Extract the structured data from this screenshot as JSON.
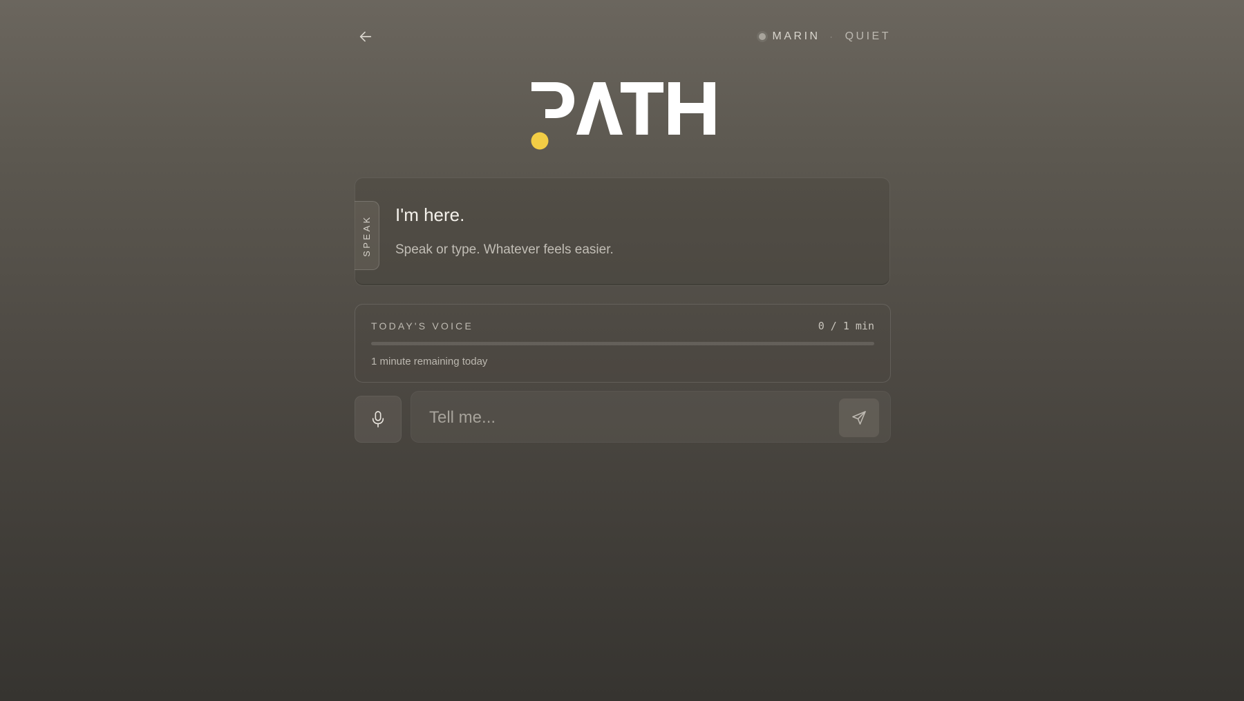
{
  "header": {
    "back_icon": "arrow-left-icon",
    "status_dot_color": "#a8a49c",
    "name": "MARIN",
    "separator": "·",
    "mode": "QUIET"
  },
  "logo": {
    "text": "PATH",
    "dot_color": "#f2cd45",
    "text_color": "#ffffff"
  },
  "prompt_card": {
    "tab_label": "SPEAK",
    "title": "I'm here.",
    "subtitle": "Speak or type. Whatever feels easier."
  },
  "voice_usage": {
    "label": "TODAY'S VOICE",
    "count": "0 / 1 min",
    "used_fraction": 0,
    "remaining_text": "1 minute remaining today"
  },
  "composer": {
    "mic_icon": "microphone-icon",
    "placeholder": "Tell me...",
    "value": "",
    "send_icon": "send-icon"
  }
}
